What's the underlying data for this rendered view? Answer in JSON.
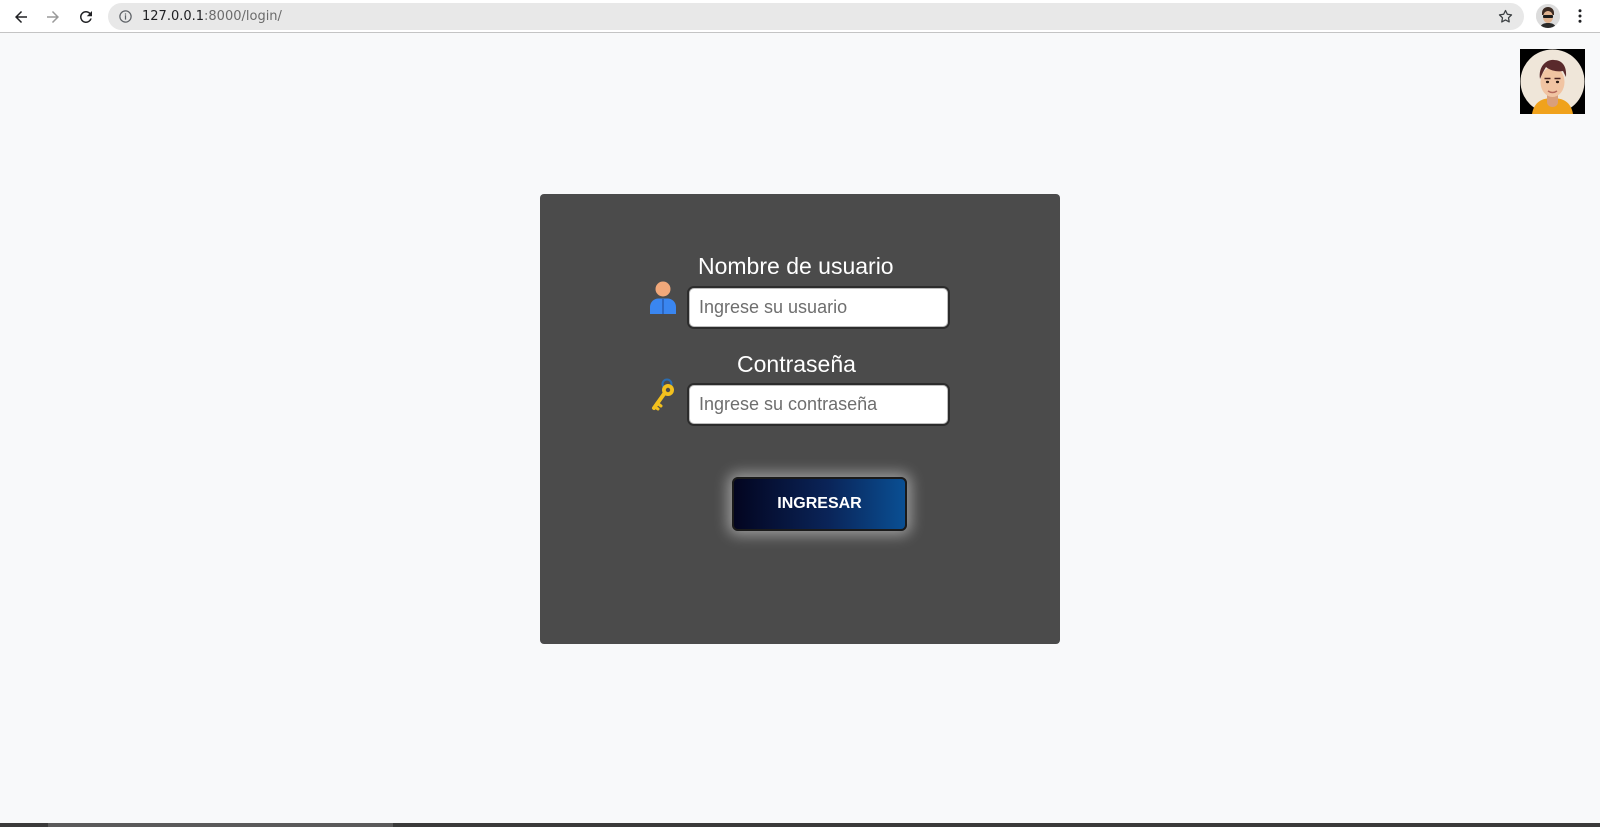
{
  "browser": {
    "url_host": "127.0.0.1",
    "url_rest": ":8000/login/"
  },
  "login": {
    "username_label": "Nombre de usuario",
    "username_placeholder": "Ingrese su usuario",
    "password_label": "Contraseña",
    "password_placeholder": "Ingrese su contraseña",
    "submit_label": "INGRESAR"
  },
  "colors": {
    "page_bg": "#f8f9fa",
    "card_bg": "#4b4b4b",
    "button_gradient_start": "#030520",
    "button_gradient_end": "#0a4f93"
  },
  "icons": {
    "back": "back-arrow-icon",
    "forward": "forward-arrow-icon",
    "reload": "reload-icon",
    "site_info": "info-icon",
    "bookmark": "star-icon",
    "menu": "more-vert-icon",
    "username": "user-icon",
    "password": "key-icon"
  }
}
